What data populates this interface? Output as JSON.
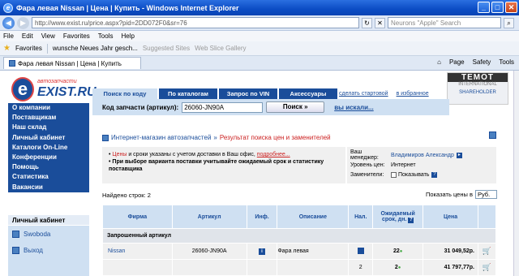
{
  "window": {
    "title": "Фара левая Nissan | Цена | Купить - Windows Internet Explorer"
  },
  "address": {
    "url": "http://www.exist.ru/price.aspx?pid=2DD072F0&sr=76",
    "search_placeholder": "Neurons \"Apple\" Search"
  },
  "menu": [
    "File",
    "Edit",
    "View",
    "Favorites",
    "Tools",
    "Help"
  ],
  "favorites": {
    "label": "Favorites",
    "items": [
      "wunsche Neues Jahr gesch...",
      "Suggested Sites",
      "Web Slice Gallery"
    ]
  },
  "tab": {
    "label": "Фара левая Nissan | Цена | Купить"
  },
  "toolbar_right": [
    "Page",
    "Safety",
    "Tools"
  ],
  "logo": {
    "main": "EXIST.RU",
    "sub": "автозапчасти"
  },
  "badge": {
    "brand": "TEMOT",
    "line2": "INTERNATIONAL",
    "line3": "SHAREHOLDER"
  },
  "nav_tabs": [
    "Поиск по коду",
    "По каталогам",
    "Запрос по VIN",
    "Аксессуары"
  ],
  "top_links": [
    "сделать стартовой",
    "в избранное"
  ],
  "search": {
    "label": "Код запчасти (артикул):",
    "value": "26060-JN90A",
    "button": "Поиск »",
    "advanced": "вы искали..."
  },
  "sidebar": [
    "О компании",
    "Поставщикам",
    "Наш склад",
    "Личный кабинет",
    "Каталоги On-Line",
    "Конференции",
    "Помощь",
    "Статистика",
    "Вакансии"
  ],
  "account": {
    "title": "Личный кабинет",
    "items": [
      "Swoboda",
      "Выход"
    ]
  },
  "breadcrumb": {
    "home": "Интернет-магазин автозапчастей",
    "sep": "»",
    "current": "Результат поиска цен и заменителей"
  },
  "notice": {
    "line1_red": "Цены",
    "line1_rest": " и сроки указаны с учетом доставки в Ваш офис,",
    "line1_link": "подробнее...",
    "line2": "При выборе варианта поставки учитывайте ожидаемый срок и статистику поставщика"
  },
  "manager": {
    "label_manager": "Ваш менеджер:",
    "manager": "Владимиров Александр",
    "label_level": "Уровень цен:",
    "level": "Интернет",
    "label_subst": "Заменители:",
    "subst": "Показывать"
  },
  "found": "Найдено строк: 2",
  "currency": {
    "label": "Показать цены в",
    "value": "Руб."
  },
  "table": {
    "headers": [
      "Фирма",
      "Артикул",
      "Инф.",
      "Описание",
      "Нал.",
      "Ожидаемый срок, дн.",
      "Цена"
    ],
    "group": "Запрошенный артикул",
    "rows": [
      {
        "firm": "Nissan",
        "article": "26060-JN90A",
        "desc": "Фара левая",
        "term": "22",
        "price": "31 049,52р."
      },
      {
        "firm": "",
        "article": "",
        "desc": "",
        "stock": "2",
        "term": "2",
        "price": "41 797,77р."
      }
    ]
  }
}
